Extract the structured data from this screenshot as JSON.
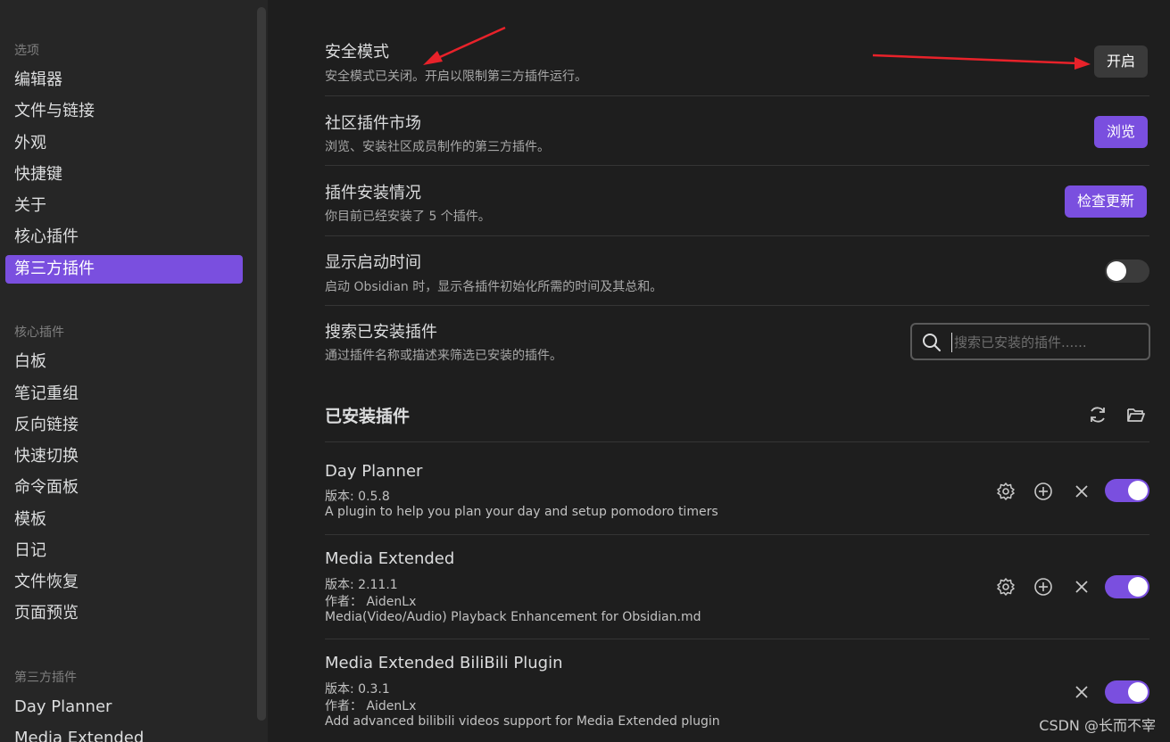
{
  "sidebar": {
    "section_options": "选项",
    "options": [
      "编辑器",
      "文件与链接",
      "外观",
      "快捷键",
      "关于",
      "核心插件",
      "第三方插件"
    ],
    "active_index": 6,
    "section_core": "核心插件",
    "core": [
      "白板",
      "笔记重组",
      "反向链接",
      "快速切换",
      "命令面板",
      "模板",
      "日记",
      "文件恢复",
      "页面预览"
    ],
    "section_third": "第三方插件",
    "third": [
      "Day Planner",
      "Media Extended"
    ]
  },
  "settings": {
    "safe_mode": {
      "name": "安全模式",
      "desc": "安全模式已关闭。开启以限制第三方插件运行。",
      "button": "开启"
    },
    "community": {
      "name": "社区插件市场",
      "desc": "浏览、安装社区成员制作的第三方插件。",
      "button": "浏览"
    },
    "install_status": {
      "name": "插件安装情况",
      "desc": "你目前已经安装了 5 个插件。",
      "button": "检查更新"
    },
    "startup_time": {
      "name": "显示启动时间",
      "desc": "启动 Obsidian 时，显示各插件初始化所需的时间及其总和。",
      "enabled": false
    },
    "search": {
      "name": "搜索已安装插件",
      "desc": "通过插件名称或描述来筛选已安装的插件。",
      "placeholder": "搜索已安装的插件......"
    }
  },
  "installed": {
    "title": "已安装插件",
    "plugins": [
      {
        "name": "Day Planner",
        "version": "版本: 0.5.8",
        "description": "A plugin to help you plan your day and setup pomodoro timers",
        "enabled": true
      },
      {
        "name": "Media Extended",
        "version": "版本: 2.11.1",
        "author": "作者： AidenLx",
        "description": "Media(Video/Audio) Playback Enhancement for Obsidian.md",
        "enabled": true
      },
      {
        "name": "Media Extended BiliBili Plugin",
        "version": "版本: 0.3.1",
        "author": "作者： AidenLx",
        "description": "Add advanced bilibili videos support for Media Extended plugin",
        "enabled": true
      }
    ]
  },
  "colors": {
    "accent": "#7a4fdf",
    "arrow": "#e8222a"
  },
  "icons": {
    "search": "search-icon",
    "reload": "reload-icon",
    "folder": "folder-open-icon",
    "settings": "gear-icon",
    "hotkey": "plus-circle-icon",
    "uninstall": "close-icon"
  },
  "watermark": "CSDN @长而不宰"
}
